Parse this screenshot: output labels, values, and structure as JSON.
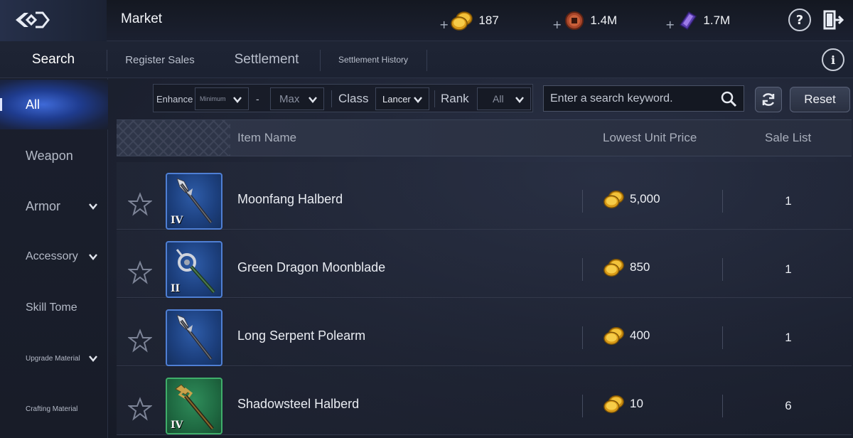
{
  "header": {
    "title": "Market",
    "currencies": [
      {
        "icon": "gold-coins-icon",
        "plus": "+",
        "value": "187"
      },
      {
        "icon": "bronze-coin-icon",
        "plus": "+",
        "value": "1.4M"
      },
      {
        "icon": "purple-crystal-icon",
        "plus": "+",
        "value": "1.7M"
      }
    ],
    "help_label": "?",
    "exit_icon": "exit-door-icon"
  },
  "tabs": [
    {
      "label": "Search"
    },
    {
      "label": "Register Sales"
    },
    {
      "label": "Settlement"
    },
    {
      "label": "Settlement History"
    }
  ],
  "info_label": "i",
  "sidebar": {
    "items": [
      {
        "label": "All"
      },
      {
        "label": "Weapon"
      },
      {
        "label": "Armor"
      },
      {
        "label": "Accessory"
      },
      {
        "label": "Skill Tome"
      },
      {
        "label": "Upgrade Material"
      },
      {
        "label": "Crafting Material"
      }
    ]
  },
  "filters": {
    "enhance_label": "Enhance",
    "enhance_min": "Minimum",
    "dash": "-",
    "enhance_max": "Max",
    "class_label": "Class",
    "class_value": "Lancer",
    "rank_label": "Rank",
    "rank_value": "All"
  },
  "search": {
    "placeholder": "Enter a search keyword."
  },
  "reset_label": "Reset",
  "table": {
    "headers": {
      "name": "Item Name",
      "price": "Lowest Unit Price",
      "sale": "Sale List"
    },
    "rows": [
      {
        "name": "Moonfang Halberd",
        "tier": "IV",
        "price": "5,000",
        "sale": "1",
        "frame": "blue"
      },
      {
        "name": "Green Dragon Moonblade",
        "tier": "II",
        "price": "850",
        "sale": "1",
        "frame": "blue"
      },
      {
        "name": "Long Serpent Polearm",
        "tier": "",
        "price": "400",
        "sale": "1",
        "frame": "blue"
      },
      {
        "name": "Shadowsteel Halberd",
        "tier": "IV",
        "price": "10",
        "sale": "6",
        "frame": "green"
      }
    ]
  },
  "colors": {
    "accent_blue": "#3f6ad8",
    "gold": "#e8b020",
    "rare_green": "#3fae6a",
    "frame_blue": "#4f7fd4"
  }
}
